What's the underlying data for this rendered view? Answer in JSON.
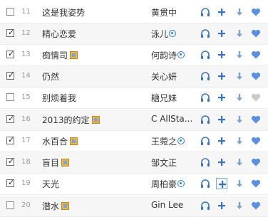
{
  "colors": {
    "accent_blue": "#3b73b9",
    "heart_blue": "#5b8fe0",
    "heart_grey": "#c9c9c9",
    "text": "#333333",
    "number": "#9a9a9a"
  },
  "songs": [
    {
      "number": "11",
      "title": "这是我姿势",
      "artist": "黄贯中",
      "checked": false,
      "has_tag": false,
      "artist_badge": false,
      "favorite": true
    },
    {
      "number": "12",
      "title": "精心恋爱",
      "artist": "泳儿",
      "checked": true,
      "has_tag": false,
      "artist_badge": true,
      "favorite": true
    },
    {
      "number": "13",
      "title": "痴情司",
      "artist": "何韵诗",
      "checked": true,
      "has_tag": true,
      "artist_badge": true,
      "favorite": true
    },
    {
      "number": "14",
      "title": "仍然",
      "artist": "关心妍",
      "checked": true,
      "has_tag": false,
      "artist_badge": false,
      "favorite": true
    },
    {
      "number": "15",
      "title": "别烦着我",
      "artist": "糖兄妹",
      "checked": false,
      "has_tag": false,
      "artist_badge": false,
      "favorite": false
    },
    {
      "number": "16",
      "title": "2013的约定",
      "artist": "C AllSta...",
      "checked": true,
      "has_tag": true,
      "artist_badge": false,
      "favorite": true
    },
    {
      "number": "17",
      "title": "水百合",
      "artist": "王菀之",
      "checked": true,
      "has_tag": true,
      "artist_badge": true,
      "favorite": true
    },
    {
      "number": "18",
      "title": "盲目",
      "artist": "邹文正",
      "checked": true,
      "has_tag": true,
      "artist_badge": false,
      "favorite": true
    },
    {
      "number": "19",
      "title": "天光",
      "artist": "周柏豪",
      "checked": true,
      "has_tag": false,
      "artist_badge": true,
      "favorite": true,
      "add_focused": true
    },
    {
      "number": "20",
      "title": "潜水",
      "artist": "Gin Lee",
      "checked": false,
      "has_tag": true,
      "artist_badge": false,
      "favorite": true
    }
  ],
  "icons": {
    "listen": "headphones-icon",
    "add": "plus-icon",
    "download": "download-arrow-icon",
    "favorite": "heart-icon",
    "tag": "music-tag-icon",
    "artist_badge": "artist-badge-icon"
  }
}
